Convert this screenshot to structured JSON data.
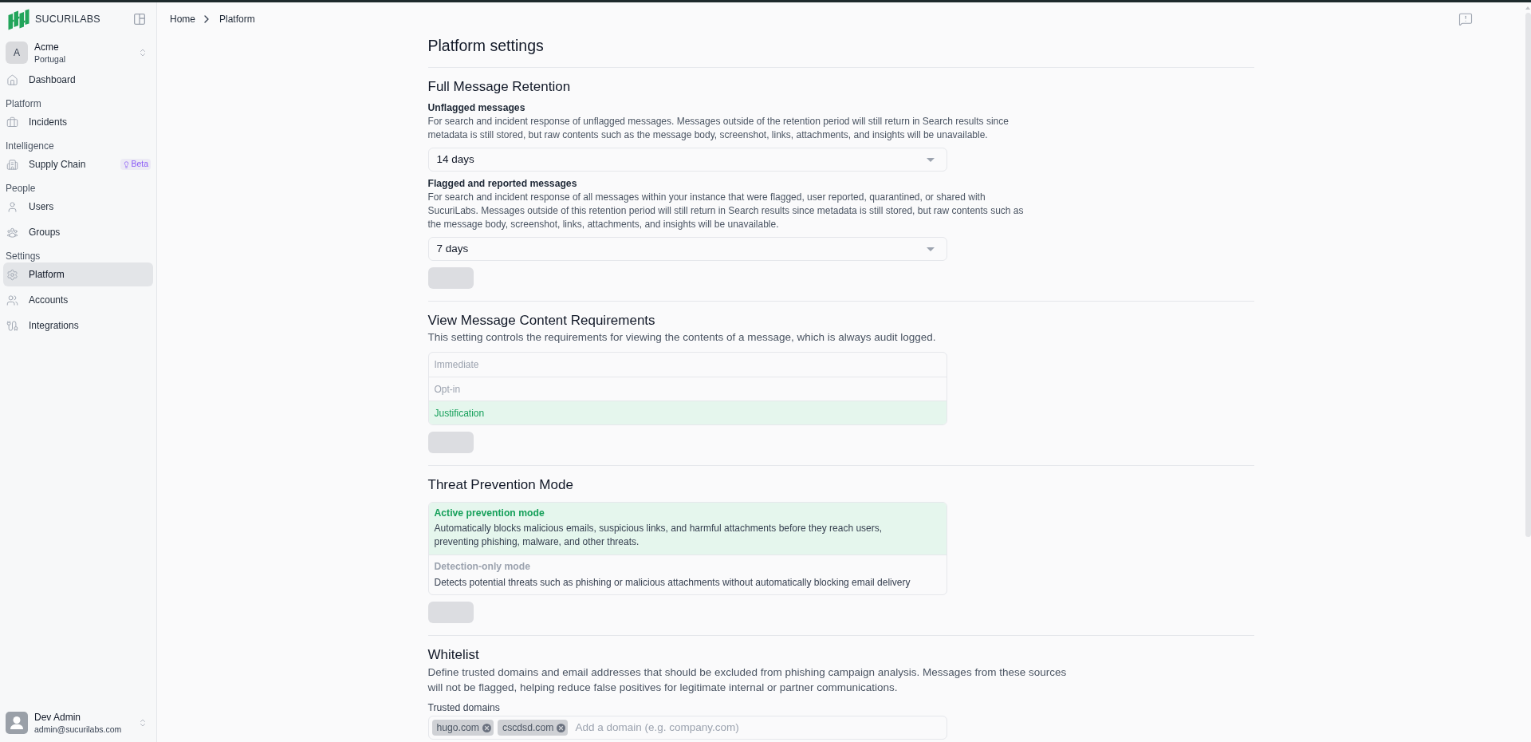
{
  "sidebar": {
    "brand": "SUCURILABS",
    "org": {
      "initial": "A",
      "name": "Acme",
      "region": "Portugal"
    },
    "nav_top": [
      {
        "label": "Dashboard",
        "selected": false
      }
    ],
    "groups": [
      {
        "title": "Platform",
        "items": [
          {
            "label": "Incidents",
            "selected": false
          }
        ]
      },
      {
        "title": "Intelligence",
        "items": [
          {
            "label": "Supply Chain",
            "selected": false,
            "badge": "Beta"
          }
        ]
      },
      {
        "title": "People",
        "items": [
          {
            "label": "Users",
            "selected": false
          },
          {
            "label": "Groups",
            "selected": false
          }
        ]
      },
      {
        "title": "Settings",
        "items": [
          {
            "label": "Platform",
            "selected": true
          },
          {
            "label": "Accounts",
            "selected": false
          },
          {
            "label": "Integrations",
            "selected": false
          }
        ]
      }
    ],
    "user": {
      "name": "Dev Admin",
      "email": "admin@sucurilabs.com"
    }
  },
  "breadcrumb": [
    "Home",
    "Platform"
  ],
  "page_title": "Platform settings",
  "sections": [
    {
      "kind": "retention",
      "title": "Full Message Retention",
      "fields": [
        {
          "title": "Unflagged messages",
          "description": "For search and incident response of unflagged messages. Messages outside of the retention period will still return in Search results since metadata is still stored, but raw contents such as the message body, screenshot, links, attachments, and insights will be unavailable.",
          "dropdown": {
            "value": "14 days"
          }
        },
        {
          "title": "Flagged and reported messages",
          "description": "For search and incident response of all messages within your instance that were flagged, user reported, quarantined, or shared with SucuriLabs. Messages outside of this retention period will still return in Search results since metadata is still stored, but raw contents such as the message body, screenshot, links, attachments, and insights will be unavailable.",
          "dropdown": {
            "value": "7 days"
          }
        }
      ],
      "save": {
        "disabled": true
      }
    },
    {
      "kind": "list",
      "title": "View Message Content Requirements",
      "description": "This setting controls the requirements for viewing the contents of a message, which is always audit logged.",
      "options": [
        {
          "label": "Immediate",
          "selected": false
        },
        {
          "label": "Opt-in",
          "selected": false
        },
        {
          "label": "Justification",
          "selected": true
        }
      ],
      "save": {
        "disabled": true
      }
    },
    {
      "kind": "cards",
      "title": "Threat Prevention Mode",
      "options": [
        {
          "label": "Active prevention mode",
          "description": "Automatically blocks malicious emails, suspicious links, and harmful attachments before they reach users, preventing phishing, malware, and other threats.",
          "selected": true
        },
        {
          "label": "Detection-only mode",
          "description": "Detects potential threats such as phishing or malicious attachments without automatically blocking email delivery",
          "selected": false
        }
      ],
      "save": {
        "disabled": true
      }
    },
    {
      "kind": "tags",
      "title": "Whitelist",
      "description": "Define trusted domains and email addresses that should be excluded from phishing campaign analysis. Messages from these sources will not be flagged, helping reduce false positives for legitimate internal or partner communications.",
      "field_label": "Trusted domains",
      "tags": [
        "hugo.com",
        "cscdsd.com"
      ],
      "placeholder": "Add a domain (e.g. company.com)"
    }
  ]
}
